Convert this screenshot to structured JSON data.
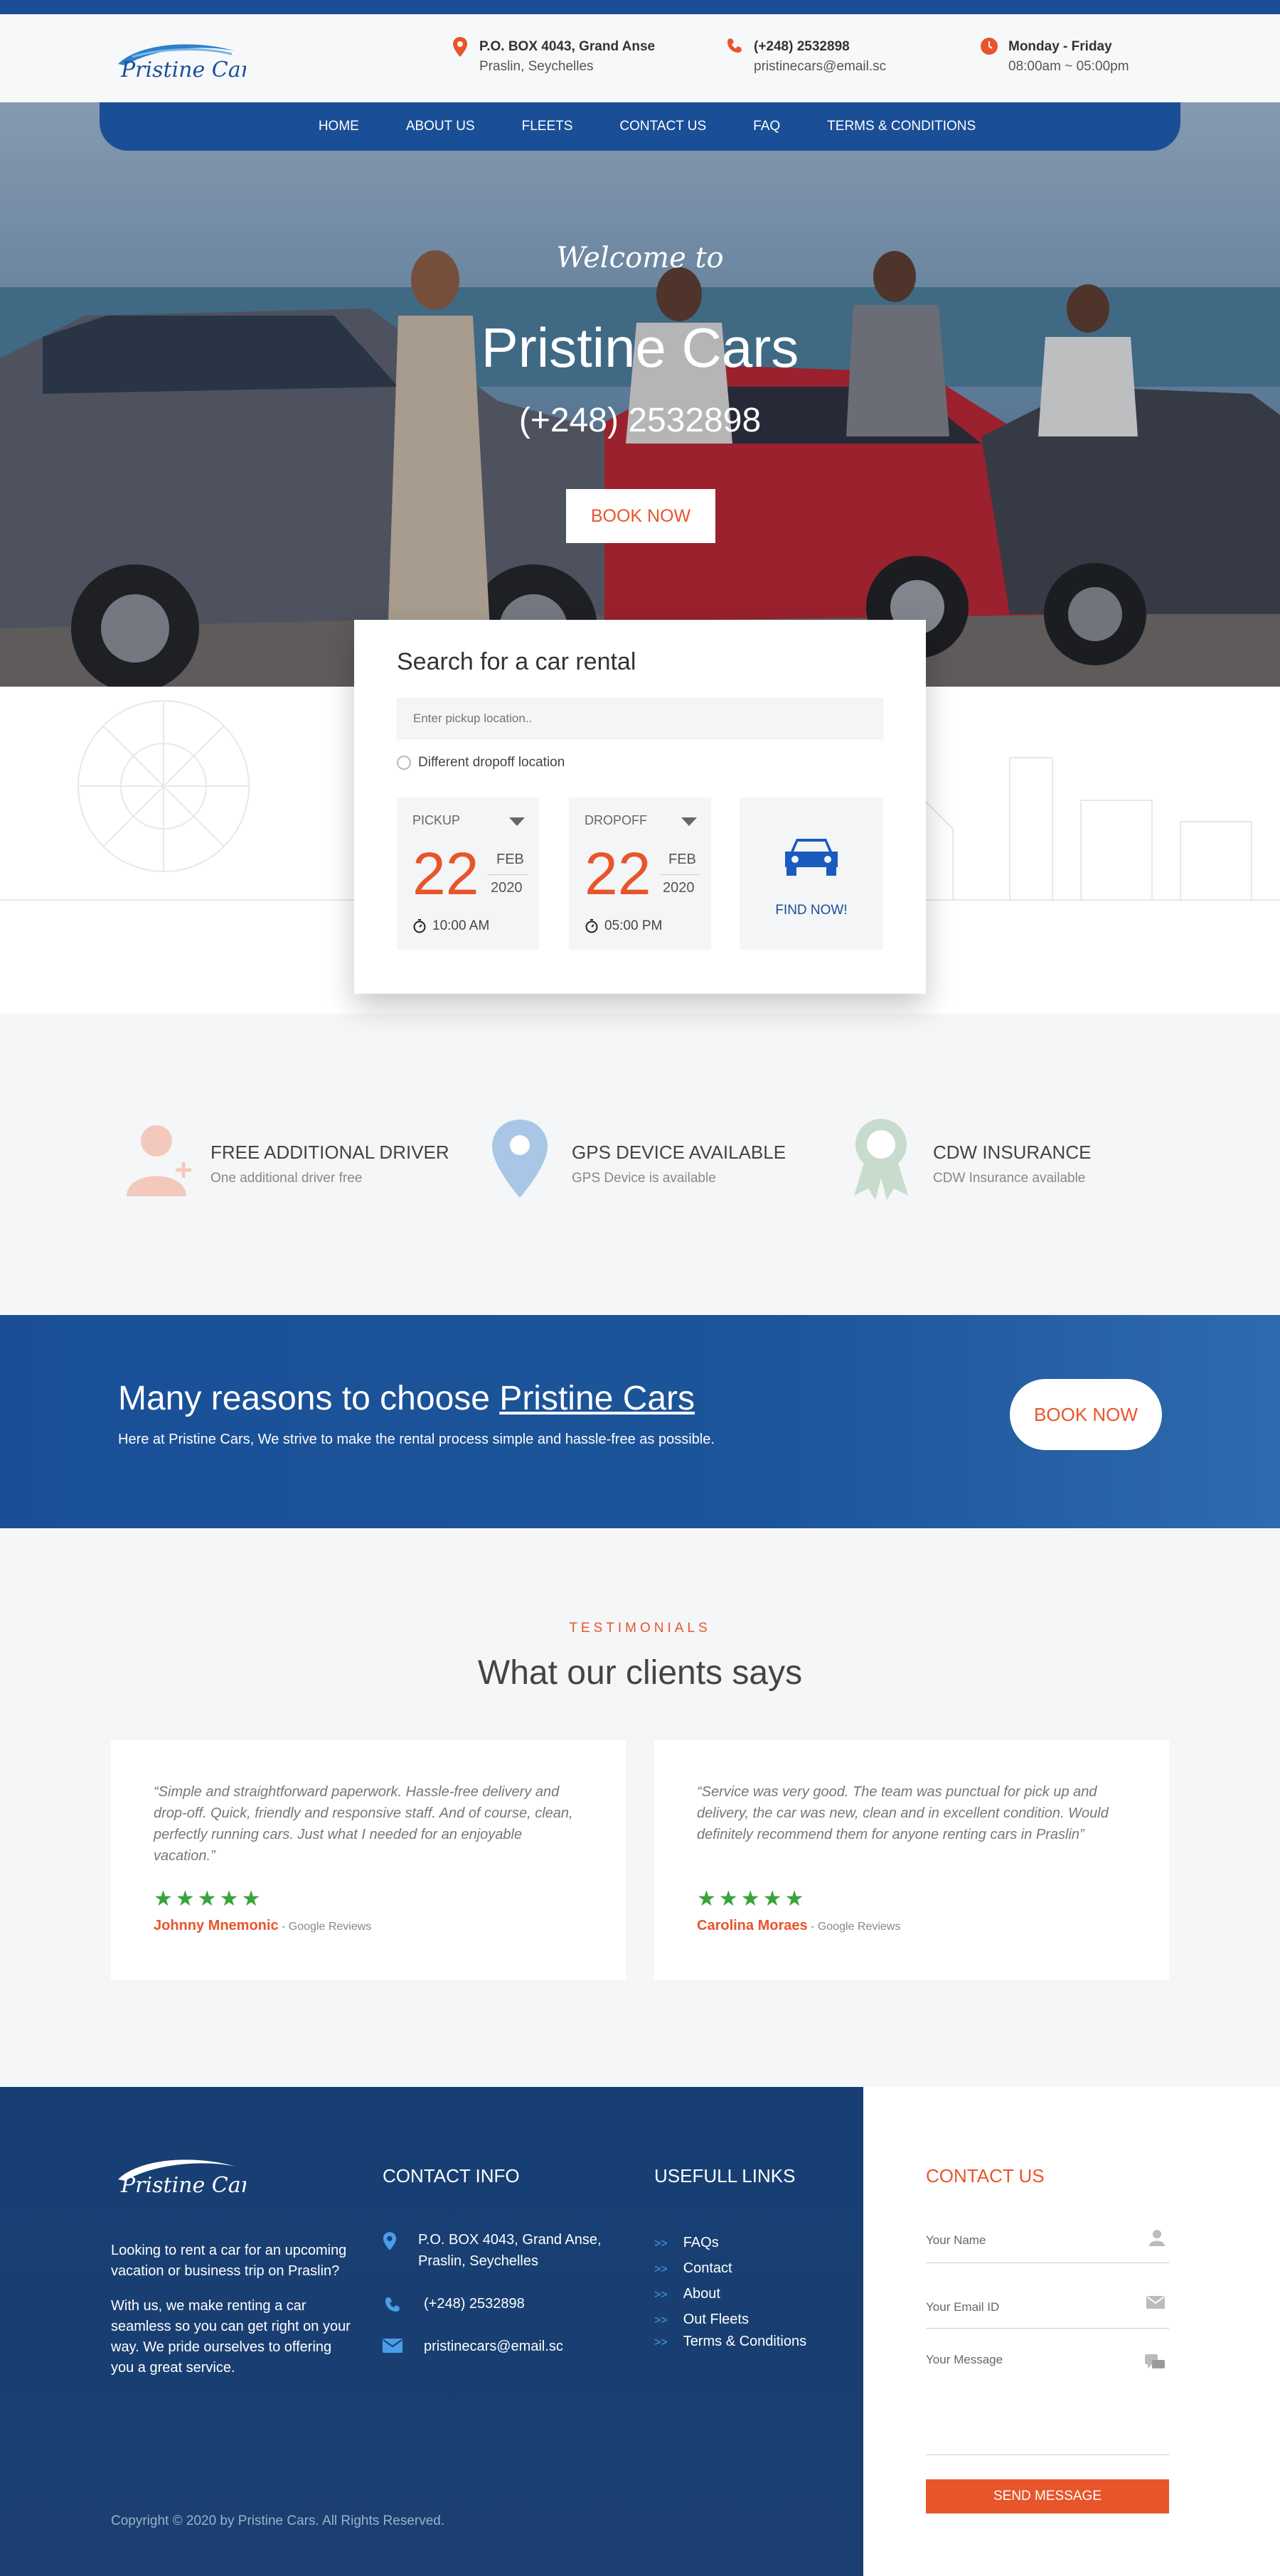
{
  "brand": {
    "logo_text": "Pristine Cars",
    "accent_color": "#e8552b",
    "primary_color": "#1a4f98"
  },
  "header": {
    "address_line1": "P.O. BOX 4043, Grand Anse",
    "address_line2": "Praslin, Seychelles",
    "phone": "(+248) 2532898",
    "email": "pristinecars@email.sc",
    "hours_line1": "Monday - Friday",
    "hours_line2": "08:00am ~ 05:00pm",
    "icons": [
      "location-pin-icon",
      "phone-icon",
      "clock-icon"
    ]
  },
  "nav": {
    "items": [
      "HOME",
      "ABOUT US",
      "FLEETS",
      "CONTACT US",
      "FAQ",
      "TERMS & CONDITIONS"
    ]
  },
  "hero": {
    "welcome": "Welcome to",
    "title": "Pristine Cars",
    "phone": "(+248) 2532898",
    "cta": "BOOK NOW"
  },
  "search": {
    "title": "Search for a car rental",
    "pickup_placeholder": "Enter pickup location..",
    "different_dropoff": "Different dropoff location",
    "pickup": {
      "label": "PICKUP",
      "day": "22",
      "month": "FEB",
      "year": "2020",
      "time": "10:00 AM"
    },
    "dropoff": {
      "label": "DROPOFF",
      "day": "22",
      "month": "FEB",
      "year": "2020",
      "time": "05:00 PM"
    },
    "find_label": "FIND NOW!"
  },
  "features": [
    {
      "title": "FREE ADDITIONAL DRIVER",
      "subtitle": "One additional driver free",
      "icon": "add-driver-icon"
    },
    {
      "title": "GPS DEVICE AVAILABLE",
      "subtitle": "GPS Device is available",
      "icon": "gps-pin-icon"
    },
    {
      "title": "CDW INSURANCE",
      "subtitle": "CDW Insurance available",
      "icon": "award-ribbon-icon"
    }
  ],
  "reasons": {
    "title_prefix": "Many reasons to choose ",
    "title_link": "Pristine Cars",
    "subtitle": "Here at Pristine Cars, We strive to make the rental process simple and hassle-free as possible.",
    "cta": "BOOK NOW"
  },
  "testimonials": {
    "kicker": "TESTIMONIALS",
    "title": "What our clients says",
    "items": [
      {
        "quote": "“Simple and straightforward paperwork. Hassle-free delivery and drop-off. Quick, friendly and responsive staff. And of course, clean, perfectly running cars. Just what I needed for an enjoyable vacation.”",
        "stars": "★★★★★",
        "name": "Johnny Mnemonic",
        "source": " - Google Reviews"
      },
      {
        "quote": "“Service was very good. The team was punctual for pick up and delivery, the car was new, clean and in excellent condition. Would definitely recommend them for anyone renting cars in Praslin”",
        "stars": "★★★★★",
        "name": "Carolina Moraes",
        "source": " - Google Reviews"
      }
    ]
  },
  "footer": {
    "about_p1": "Looking to rent a car for an upcoming vacation or business trip on Praslin?",
    "about_p2": "With us, we make renting a car seamless so you can get right on your way. We pride ourselves to offering you a great service.",
    "contact_title": "CONTACT INFO",
    "contact_address": "P.O. BOX 4043, Grand Anse, Praslin, Seychelles",
    "contact_phone": "(+248) 2532898",
    "contact_email": "pristinecars@email.sc",
    "links_title": "USEFULL LINKS",
    "links": [
      "FAQs",
      "Contact",
      "About",
      "Out Fleets",
      "Terms & Conditions"
    ],
    "link_arrow": ">>",
    "copyright": "Copyright © 2020 by Pristine Cars. All Rights Reserved.",
    "contact_us_title": "CONTACT US",
    "name_placeholder": "Your Name",
    "email_placeholder": "Your Email ID",
    "message_placeholder": "Your Message",
    "send": "SEND MESSAGE"
  }
}
